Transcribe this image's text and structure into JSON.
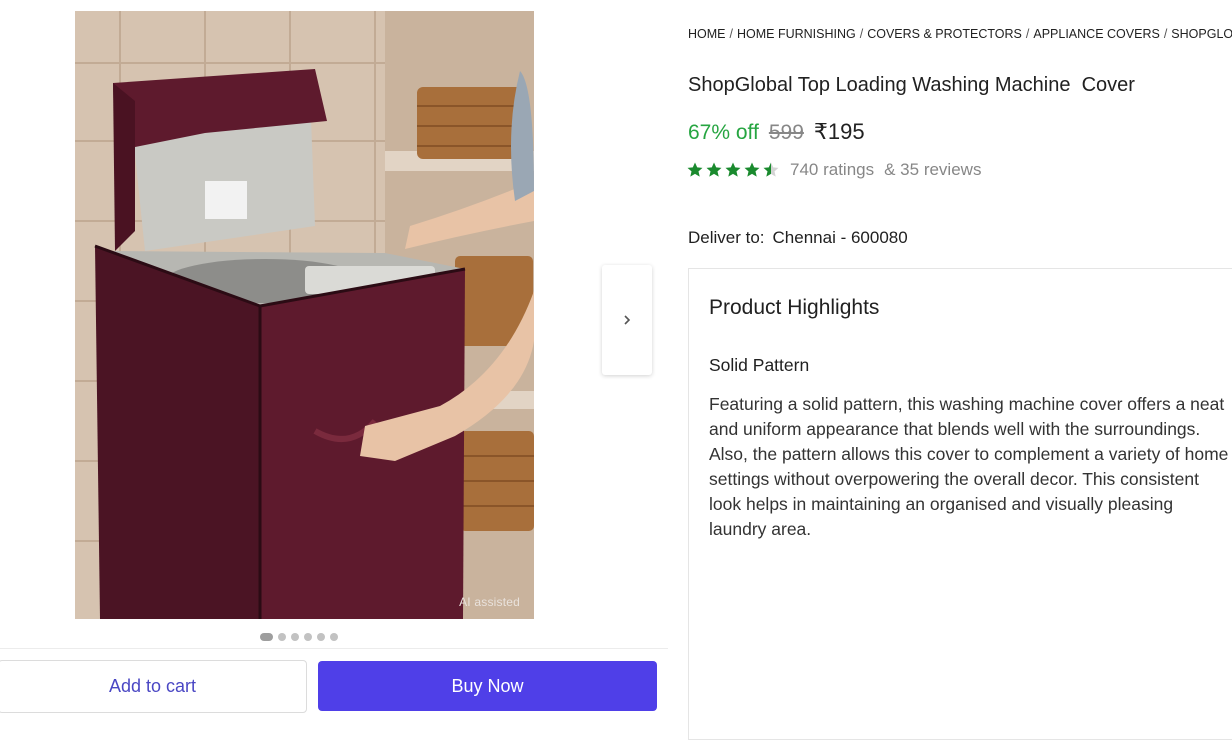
{
  "image": {
    "ai_badge": "AI assisted",
    "colors": {
      "cover": "#5e1a2d",
      "tile": "#d8c6b4",
      "basket": "#a86f3b",
      "machine": "#c9c9c4"
    }
  },
  "carousel": {
    "dots": 6,
    "active_index": 0
  },
  "breadcrumb": [
    "HOME",
    "HOME FURNISHING",
    "COVERS & PROTECTORS",
    "APPLIANCE COVERS",
    "SHOPGLOBAL"
  ],
  "product": {
    "title": "ShopGlobal Top Loading Washing Machine  Cover",
    "discount": "67% off",
    "mrp": "599",
    "price": "₹195",
    "rating_stars": 4.5,
    "ratings_text": "740 ratings",
    "reviews_text": "& 35 reviews"
  },
  "delivery": {
    "label": "Deliver to:",
    "location": "Chennai - 600080"
  },
  "highlights": {
    "title": "Product Highlights",
    "subtitle": "Solid Pattern",
    "body": "Featuring a solid pattern, this washing machine cover offers a neat and uniform appearance that blends well with the surroundings. Also, the pattern allows this cover to complement a variety of home settings without overpowering the overall decor. This consistent look helps in maintaining an organised and visually pleasing laundry area."
  },
  "actions": {
    "add_to_cart": "Add to cart",
    "buy_now": "Buy Now"
  },
  "colors": {
    "discount_green": "#26a541",
    "star_green": "#1a8a2e",
    "buy_button": "#4f3fe8",
    "cart_text": "#4a47c4"
  }
}
